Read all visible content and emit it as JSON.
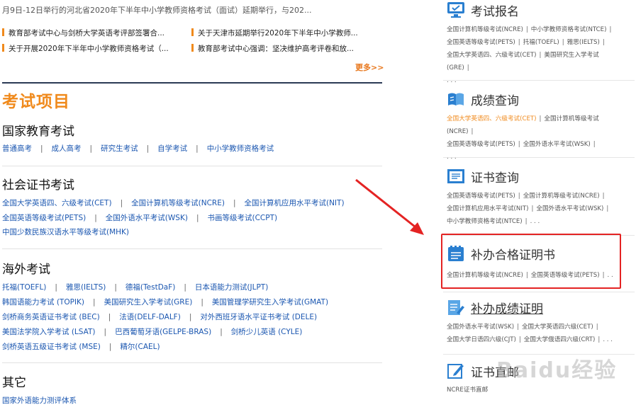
{
  "top_snippet": "月9日-12日举行的河北省2020年下半年中小学教师资格考试（面试）延期举行，与202...",
  "news": [
    "教育部考试中心与剑桥大学英语考评部签署合...",
    "关于天津市延期举行2020年下半年中小学教师...",
    "关于开展2020年下半年中小学教师资格考试（...",
    "教育部考试中心强调：坚决维护高考评卷和放..."
  ],
  "more_label": "更多>>",
  "section_title": "考试项目",
  "categories": {
    "national": {
      "title": "国家教育考试",
      "row1": [
        "普通高考",
        "成人高考",
        "研究生考试",
        "自学考试",
        "中小学教师资格考试"
      ]
    },
    "social": {
      "title": "社会证书考试",
      "row1": [
        "全国大学英语四、六级考试(CET)",
        "全国计算机等级考试(NCRE)",
        "全国计算机应用水平考试(NIT)"
      ],
      "row2": [
        "全国英语等级考试(PETS)",
        "全国外语水平考试(WSK)",
        "书画等级考试(CCPT)"
      ],
      "row3": [
        "中国少数民族汉语水平等级考试(MHK)"
      ]
    },
    "overseas": {
      "title": "海外考试",
      "row1": [
        "托福(TOEFL)",
        "雅思(IELTS)",
        "德福(TestDaF)",
        "日本语能力测试(JLPT)"
      ],
      "row2": [
        "韩国语能力考试 (TOPIK)",
        "美国研究生入学考试(GRE)",
        "美国管理学研究生入学考试(GMAT)"
      ],
      "row3": [
        "剑桥商务英语证书考试 (BEC)",
        "法语(DELF-DALF)",
        "对外西班牙语水平证书考试 (DELE)"
      ],
      "row4": [
        "美国法学院入学考试 (LSAT)",
        "巴西葡萄牙语(GELPE-BRAS)",
        "剑桥少儿英语 (CYLE)"
      ],
      "row5": [
        "剑桥英语五级证书考试 (MSE)",
        "精尔(CAEL)"
      ]
    },
    "other": {
      "title": "其它",
      "row1": [
        "国家外语能力测评体系"
      ]
    }
  },
  "right": {
    "register": {
      "title": "考试报名",
      "icon": "monitor-icon",
      "line1": [
        "全国计算机等级考试(NCRE)",
        "中小学教师资格考试(NTCE)"
      ],
      "line2": [
        "全国英语等级考试(PETS)",
        "托福(TOEFL)",
        "雅思(IELTS)"
      ],
      "line3": [
        "全国大学英语四、六级考试(CET)",
        "美国研究生入学考试(GRE)"
      ],
      "ellipsis": ". . ."
    },
    "score": {
      "title": "成绩查询",
      "icon": "book-icon",
      "line1": [
        "全国大学英语四、六级考试(CET)",
        "全国计算机等级考试(NCRE)"
      ],
      "line2": [
        "全国英语等级考试(PETS)",
        "全国外语水平考试(WSK)"
      ],
      "ellipsis": ". . ."
    },
    "cert": {
      "title": "证书查询",
      "icon": "certificate-icon",
      "line1": [
        "全国英语等级考试(PETS)",
        "全国计算机等级考试(NCRE)"
      ],
      "line2": [
        "全国计算机应用水平考试(NIT)",
        "全国外语水平考试(WSK)"
      ],
      "line3": [
        "中小学教师资格考试(NTCE)"
      ],
      "ellipsis": ". . ."
    },
    "reissue_cert": {
      "title": "补办合格证明书",
      "icon": "clipboard-icon",
      "line1": [
        "全国计算机等级考试(NCRE)",
        "全国英语等级考试(PETS)"
      ],
      "ellipsis": ". ."
    },
    "reissue_score": {
      "title": "补办成绩证明",
      "icon": "document-icon",
      "line1": [
        "全国外语水平考试(WSK)",
        "全国大学英语四六级(CET)"
      ],
      "line2": [
        "全国大学日语四六级(CJT)",
        "全国大学俄语四六级(CRT)"
      ],
      "ellipsis": ". . ."
    },
    "cert_mail": {
      "title": "证书直邮",
      "icon": "pen-icon",
      "line1": [
        "NCRE证书直邮"
      ]
    }
  },
  "watermark": "Baidu经验",
  "colors": {
    "accent": "#f08a1c",
    "link": "#1a56b0",
    "highlight": "#e42323",
    "icon": "#2a7fd0"
  }
}
